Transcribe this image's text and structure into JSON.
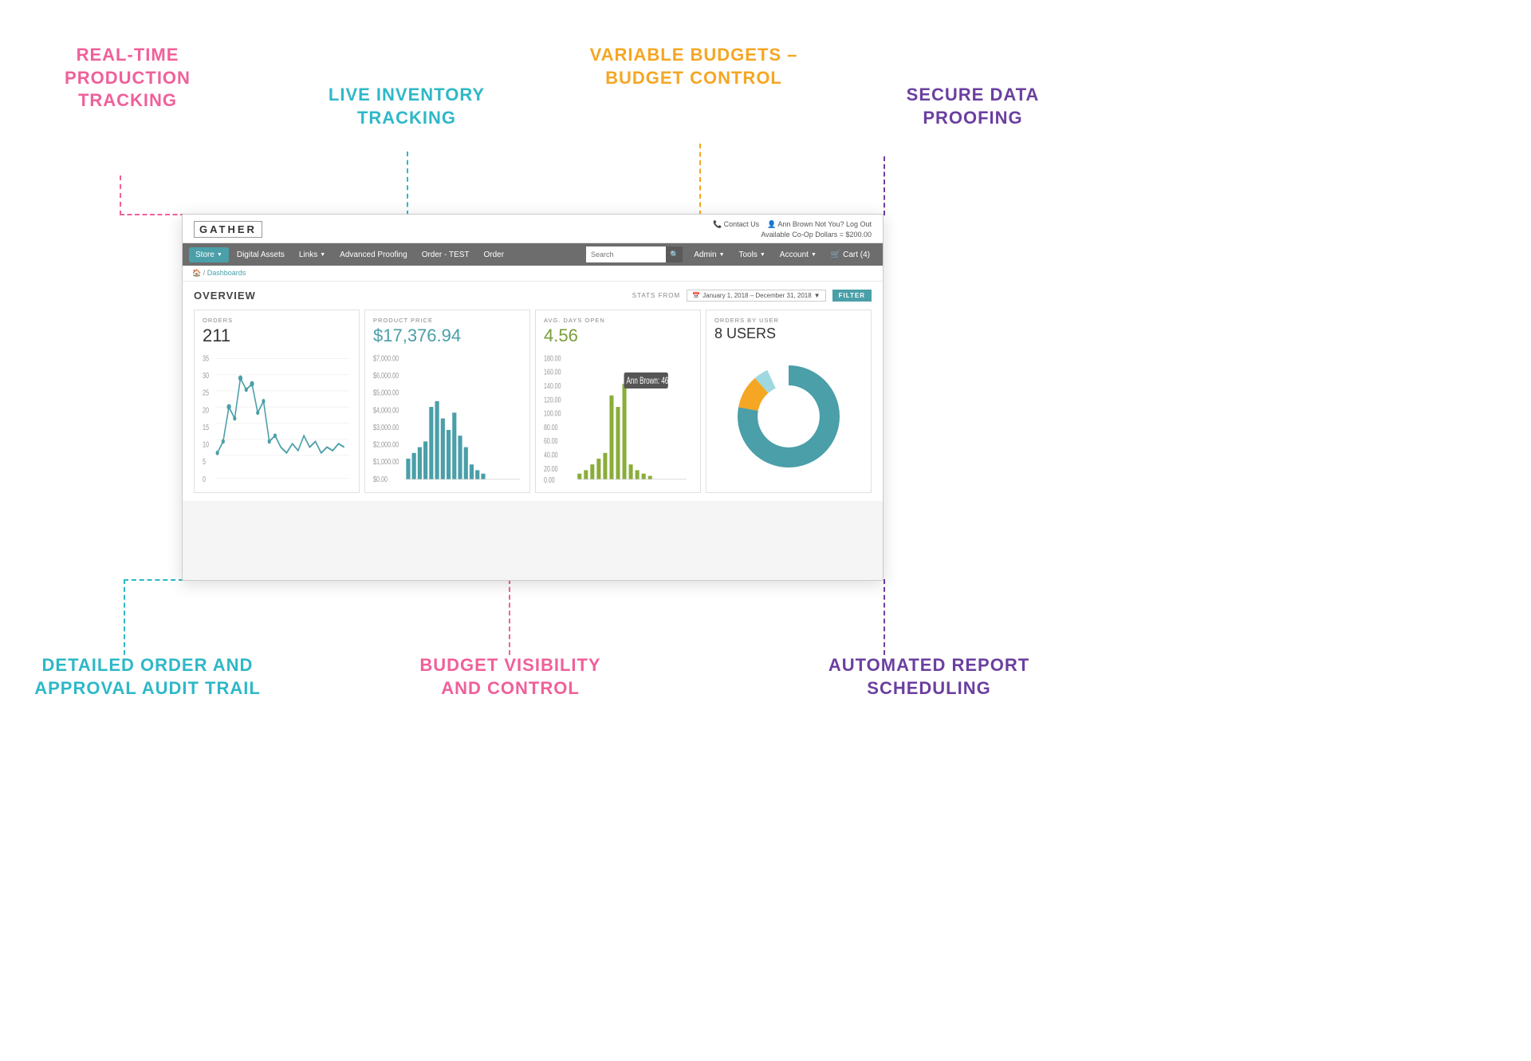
{
  "page": {
    "background": "#ffffff"
  },
  "features": {
    "top_left": {
      "label": "REAL-TIME\nPRODUCTION\nTRACKING",
      "color": "pink"
    },
    "top_center": {
      "label": "LIVE INVENTORY\nTRACKING",
      "color": "teal"
    },
    "top_right_label": {
      "label": "VARIABLE BUDGETS –\nBUDGET CONTROL",
      "color": "orange"
    },
    "top_far_right": {
      "label": "SECURE DATA\nPROOFING",
      "color": "purple"
    },
    "bottom_left": {
      "label": "DETAILED ORDER AND\nAPPROVAL AUDIT TRAIL",
      "color": "teal"
    },
    "bottom_center": {
      "label": "BUDGET VISIBILITY\nAND CONTROL",
      "color": "pink"
    },
    "bottom_right": {
      "label": "AUTOMATED REPORT\nSCHEDULING",
      "color": "purple"
    }
  },
  "browser": {
    "logo": "GATHER",
    "top_right_contact": "Contact Us",
    "top_right_user": "Ann Brown Not You? Log Out",
    "top_right_coop": "Available Co-Op Dollars = $200.00",
    "nav": {
      "items": [
        {
          "label": "Store",
          "has_dropdown": true,
          "active": true
        },
        {
          "label": "Digital Assets",
          "has_dropdown": false
        },
        {
          "label": "Links",
          "has_dropdown": true
        },
        {
          "label": "Advanced Proofing",
          "has_dropdown": false
        },
        {
          "label": "Order - TEST",
          "has_dropdown": false
        },
        {
          "label": "Order",
          "has_dropdown": false
        }
      ],
      "search_placeholder": "Search",
      "right_items": [
        {
          "label": "Admin",
          "has_dropdown": true
        },
        {
          "label": "Tools",
          "has_dropdown": true
        },
        {
          "label": "Account",
          "has_dropdown": true
        },
        {
          "label": "Cart (4)",
          "has_dropdown": false
        }
      ]
    },
    "breadcrumb": [
      "Home",
      "Dashboards"
    ],
    "overview": {
      "title": "OVERVIEW",
      "stats_from_label": "STATS FROM",
      "date_range": "January 1, 2018 – December 31, 2018",
      "filter_label": "FILTER"
    },
    "stats": [
      {
        "label": "ORDERS",
        "value": "211",
        "chart_type": "line"
      },
      {
        "label": "PRODUCT PRICE",
        "value": "$17,376.94",
        "chart_type": "bar"
      },
      {
        "label": "AVG. DAYS OPEN",
        "value": "4.56",
        "chart_type": "bar_green"
      },
      {
        "label": "ORDERS BY USER",
        "value": "8 USERS",
        "chart_type": "donut"
      }
    ]
  }
}
